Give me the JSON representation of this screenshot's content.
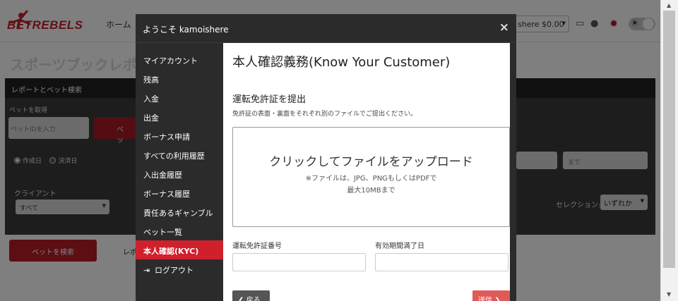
{
  "site": {
    "logo_text": "BETREBELS",
    "nav_home": "ホーム",
    "balance": "shere $0.00",
    "page_title": "スポーツブックレポー"
  },
  "report_panel": {
    "header": "レポートとベット検索",
    "get_bet_label": "ベットを取得",
    "bet_id_placeholder": "ベットIDを入力",
    "get_bet_button": "ベッ",
    "radio_created": "作成日",
    "radio_settled": "決済日",
    "date_to_placeholder": "まで",
    "client_label": "クライアント",
    "client_value": "すべて",
    "selection_label": "セレクション:",
    "selection_value": "いずれか",
    "search_button": "ベットを検索",
    "report_label": "レポ"
  },
  "modal": {
    "title": "ようこそ kamoishere",
    "close": "×",
    "menu": [
      {
        "label": "マイアカウント",
        "active": false
      },
      {
        "label": "残高",
        "active": false
      },
      {
        "label": "入金",
        "active": false
      },
      {
        "label": "出金",
        "active": false
      },
      {
        "label": "ボーナス申請",
        "active": false
      },
      {
        "label": "すべての利用履歴",
        "active": false
      },
      {
        "label": "入出金履歴",
        "active": false
      },
      {
        "label": "ボーナス履歴",
        "active": false
      },
      {
        "label": "責任あるギャンブル",
        "active": false
      },
      {
        "label": "ベット一覧",
        "active": false
      },
      {
        "label": "本人確認(KYC)",
        "active": true
      },
      {
        "label": "ログアウト",
        "active": false
      }
    ],
    "kyc": {
      "title": "本人確認義務(Know Your Customer)",
      "section": "運転免許証を提出",
      "description": "免許証の表面・裏面をそれぞれ別のファイルでご提出ください。",
      "upload_main": "クリックしてファイルをアップロード",
      "upload_note1": "※ファイルは、JPG、PNGもしくはPDFで",
      "upload_note2": "最大10MBまで",
      "license_number_label": "運転免許証番号",
      "expiry_label": "有効期間満了日",
      "back_button": "戻る",
      "send_button": "送信"
    }
  },
  "colors": {
    "brand_red": "#c8202c",
    "active_menu": "#d0202c",
    "modal_bg": "#2b2b2b"
  }
}
